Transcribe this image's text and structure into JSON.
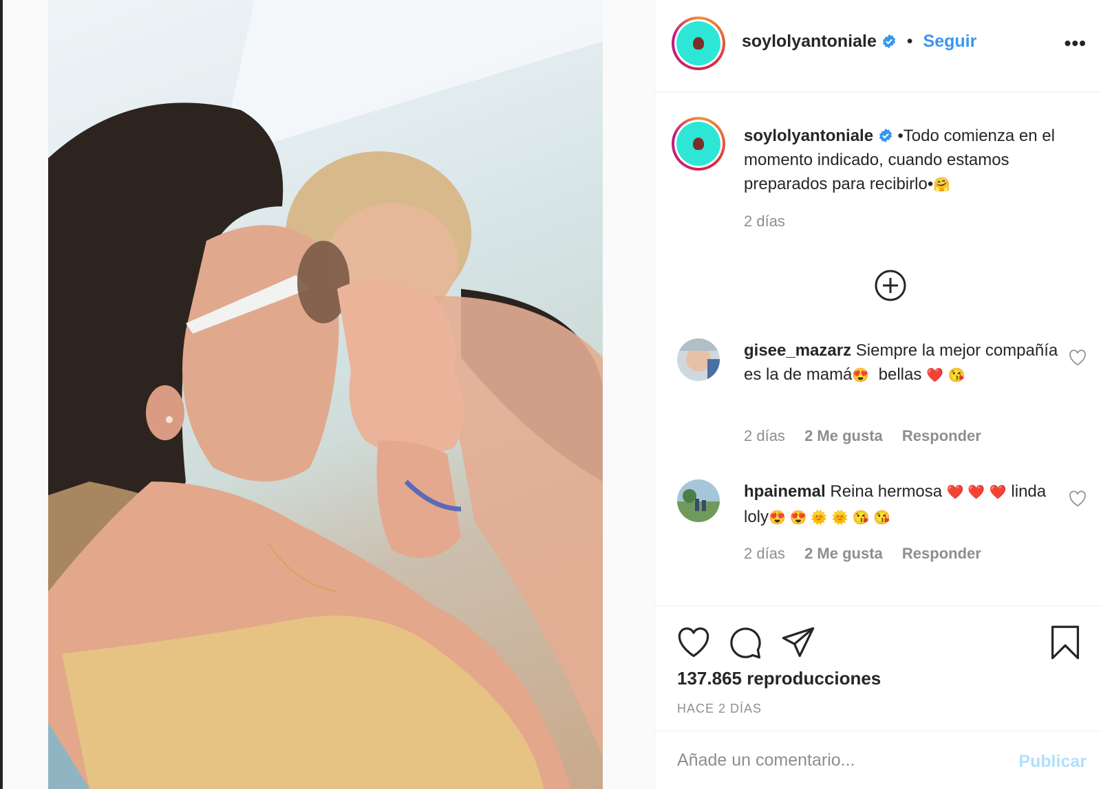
{
  "post": {
    "username": "soylolyantoniale",
    "follow_label": "Seguir",
    "separator": "•",
    "more_label": "•••"
  },
  "caption": {
    "username": "soylolyantoniale",
    "text": "•Todo comienza en el momento indicado, cuando estamos preparados para recibirlo•",
    "emoji": "🤗",
    "time": "2 días"
  },
  "comments": [
    {
      "username": "gisee_mazarz",
      "text_1": "Siempre la mejor compañía es la de mamá",
      "emoji_1": "😍",
      "text_2": "bellas",
      "emoji_2": "❤️",
      "emoji_3": "😘",
      "time": "2 días",
      "likes": "2 Me gusta",
      "reply": "Responder"
    },
    {
      "username": "hpainemal",
      "text_1": "Reina hermosa",
      "emoji_1": "❤️ ❤️",
      "emoji_2": "❤️",
      "text_2": "linda loly",
      "emoji_3": "😍 😍 🌞 🌞 😘 😘",
      "time": "2 días",
      "likes": "2 Me gusta",
      "reply": "Responder"
    }
  ],
  "stats": {
    "views": "137.865 reproducciones",
    "ago": "HACE 2 DÍAS"
  },
  "add_comment": {
    "placeholder": "Añade un comentario...",
    "publish_label": "Publicar"
  },
  "colors": {
    "link_blue": "#3897f0",
    "publish_disabled": "#b2dffc",
    "muted_text": "#8e8e8e",
    "avatar_bg": "#2ee6d6"
  },
  "icons": [
    "verified-badge-icon",
    "more-options-icon",
    "load-more-plus-icon",
    "like-heart-icon",
    "comment-bubble-icon",
    "share-paper-plane-icon",
    "save-bookmark-icon",
    "comment-like-heart-icon"
  ]
}
